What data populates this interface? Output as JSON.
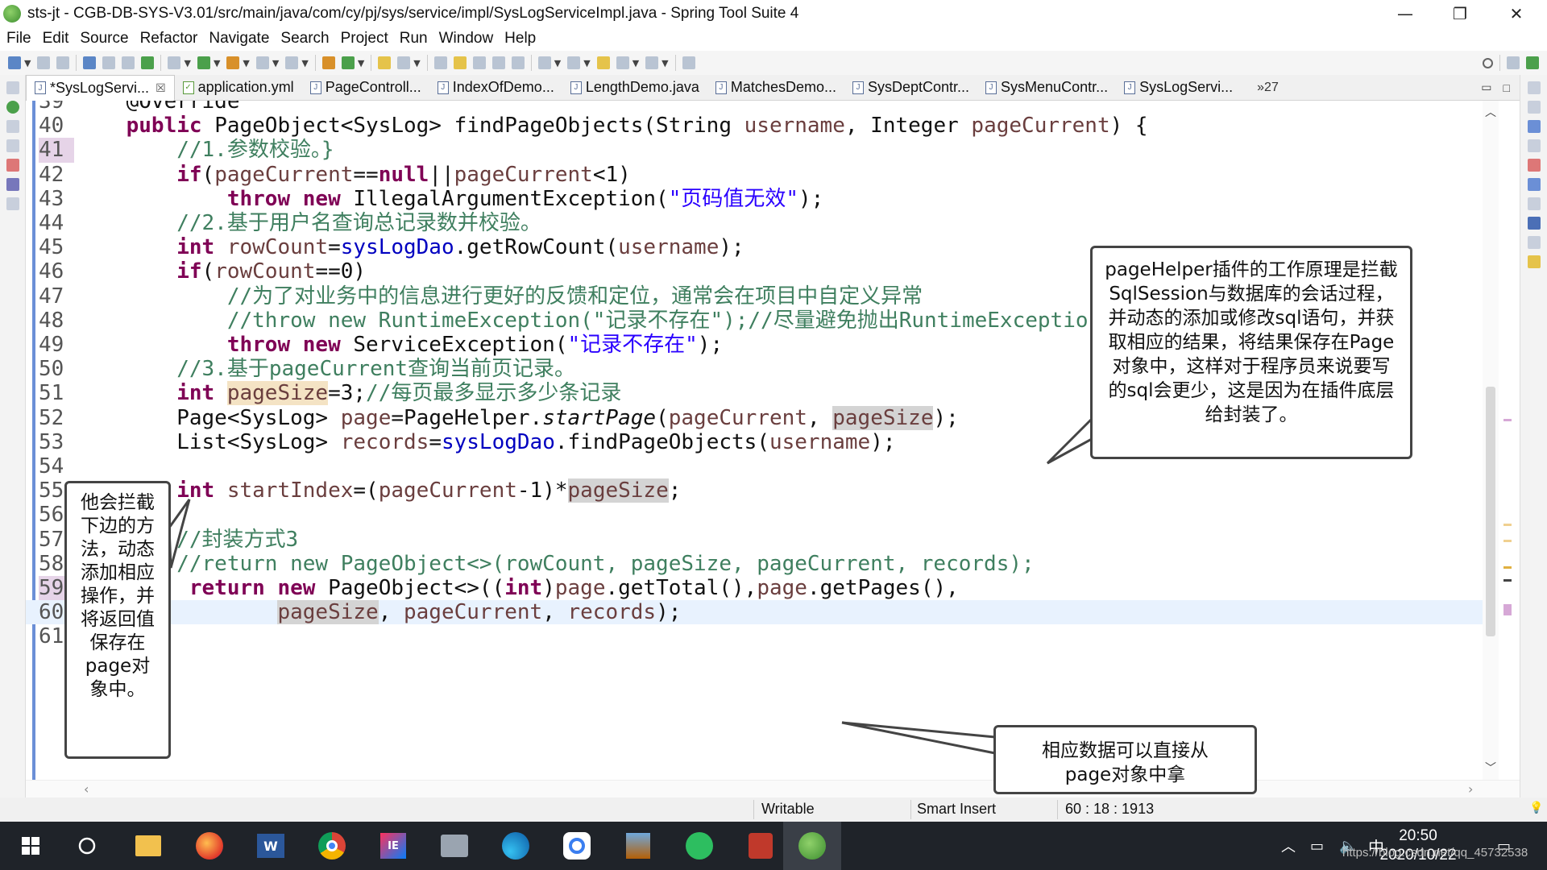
{
  "window": {
    "title": "sts-jt - CGB-DB-SYS-V3.01/src/main/java/com/cy/pj/sys/service/impl/SysLogServiceImpl.java - Spring Tool Suite 4",
    "minimize": "—",
    "restore": "❐",
    "close": "✕"
  },
  "menu": [
    "File",
    "Edit",
    "Source",
    "Refactor",
    "Navigate",
    "Search",
    "Project",
    "Run",
    "Window",
    "Help"
  ],
  "tabs": [
    {
      "label": "*SysLogServi...",
      "active": true,
      "close": "☒"
    },
    {
      "label": "application.yml"
    },
    {
      "label": "PageControll..."
    },
    {
      "label": "IndexOfDemo..."
    },
    {
      "label": "LengthDemo.java"
    },
    {
      "label": "MatchesDemo..."
    },
    {
      "label": "SysDeptContr..."
    },
    {
      "label": "SysMenuContr..."
    },
    {
      "label": "SysLogServi..."
    }
  ],
  "tabs_overflow": "»27",
  "code": {
    "lines": [
      {
        "n": "39",
        "segs": [
          [
            "",
            "    @Override"
          ]
        ]
      },
      {
        "n": "40",
        "segs": [
          [
            "kw",
            "    public "
          ],
          [
            "",
            "PageObject<SysLog> findPageObjects(String "
          ],
          [
            "var",
            "username"
          ],
          [
            "",
            ", Integer "
          ],
          [
            "var",
            "pageCurrent"
          ],
          [
            "",
            ") {"
          ]
        ]
      },
      {
        "n": "41",
        "segs": [
          [
            "cm",
            "        //1.参数校验。}"
          ]
        ],
        "lnhl": true
      },
      {
        "n": "42",
        "segs": [
          [
            "kw",
            "        if"
          ],
          [
            "",
            "("
          ],
          [
            "var",
            "pageCurrent"
          ],
          [
            "",
            "=="
          ],
          [
            "kw",
            "null"
          ],
          [
            "",
            "||"
          ],
          [
            "var",
            "pageCurrent"
          ],
          [
            "",
            "<1)"
          ]
        ]
      },
      {
        "n": "43",
        "segs": [
          [
            "kw",
            "            throw new "
          ],
          [
            "",
            "IllegalArgumentException("
          ],
          [
            "st",
            "\"页码值无效\""
          ],
          [
            "",
            ");"
          ]
        ]
      },
      {
        "n": "44",
        "segs": [
          [
            "cm",
            "        //2.基于用户名查询总记录数并校验。"
          ]
        ]
      },
      {
        "n": "45",
        "segs": [
          [
            "kw",
            "        int "
          ],
          [
            "var",
            "rowCount"
          ],
          [
            "",
            "="
          ],
          [
            "fld",
            "sysLogDao"
          ],
          [
            "",
            ".getRowCount("
          ],
          [
            "var",
            "username"
          ],
          [
            "",
            ");"
          ]
        ]
      },
      {
        "n": "46",
        "segs": [
          [
            "kw",
            "        if"
          ],
          [
            "",
            "("
          ],
          [
            "var",
            "rowCount"
          ],
          [
            "",
            "==0)"
          ]
        ]
      },
      {
        "n": "47",
        "segs": [
          [
            "cm",
            "            //为了对业务中的信息进行更好的反馈和定位，通常会在项目中自定义异常"
          ]
        ]
      },
      {
        "n": "48",
        "segs": [
          [
            "cm",
            "            //throw new RuntimeException(\"记录不存在\");//尽量避免抛出RuntimeException"
          ]
        ]
      },
      {
        "n": "49",
        "segs": [
          [
            "kw",
            "            throw new "
          ],
          [
            "",
            "ServiceException("
          ],
          [
            "st",
            "\"记录不存在\""
          ],
          [
            "",
            ");"
          ]
        ]
      },
      {
        "n": "50",
        "segs": [
          [
            "cm",
            "        //3.基于pageCurrent查询当前页记录。"
          ]
        ]
      },
      {
        "n": "51",
        "segs": [
          [
            "kw",
            "        int "
          ],
          [
            "var occ",
            "pageSize"
          ],
          [
            "",
            "=3;"
          ],
          [
            "cm",
            "//每页最多显示多少条记录"
          ]
        ]
      },
      {
        "n": "52",
        "segs": [
          [
            "",
            "        Page<SysLog> "
          ],
          [
            "var",
            "page"
          ],
          [
            "",
            "=PageHelper."
          ],
          [
            "it",
            "startPage"
          ],
          [
            "",
            "("
          ],
          [
            "var",
            "pageCurrent"
          ],
          [
            "",
            ", "
          ],
          [
            "var occ2",
            "pageSize"
          ],
          [
            "",
            ");"
          ]
        ]
      },
      {
        "n": "53",
        "segs": [
          [
            "",
            "        List<SysLog> "
          ],
          [
            "var",
            "records"
          ],
          [
            "",
            "="
          ],
          [
            "fld",
            "sysLogDao"
          ],
          [
            "",
            ".findPageObjects("
          ],
          [
            "var",
            "username"
          ],
          [
            "",
            ");"
          ]
        ]
      },
      {
        "n": "54",
        "segs": [
          [
            "",
            ""
          ]
        ]
      },
      {
        "n": "55",
        "segs": [
          [
            "kw",
            "        int "
          ],
          [
            "var",
            "startIndex"
          ],
          [
            "",
            "=("
          ],
          [
            "var",
            "pageCurrent"
          ],
          [
            "",
            "-1)*"
          ],
          [
            "var occ2",
            "pageSize"
          ],
          [
            "",
            ";"
          ]
        ]
      },
      {
        "n": "56",
        "segs": [
          [
            "",
            ""
          ]
        ]
      },
      {
        "n": "57",
        "segs": [
          [
            "cm",
            "        //封装方式3"
          ]
        ]
      },
      {
        "n": "58",
        "segs": [
          [
            "cm",
            "        //return new PageObject<>(rowCount, pageSize, pageCurrent, records);"
          ]
        ]
      },
      {
        "n": "59",
        "segs": [
          [
            "kw",
            "         return new "
          ],
          [
            "",
            "PageObject<>(("
          ],
          [
            "kw",
            "int"
          ],
          [
            "",
            ")"
          ],
          [
            "var",
            "page"
          ],
          [
            "",
            ".getTotal(),"
          ],
          [
            "var",
            "page"
          ],
          [
            "",
            ".getPages(),"
          ]
        ],
        "lnhl": true
      },
      {
        "n": "60",
        "segs": [
          [
            "",
            "                "
          ],
          [
            "var occ2",
            "pageSize"
          ],
          [
            "",
            ", "
          ],
          [
            "var",
            "pageCurrent"
          ],
          [
            "",
            ", "
          ],
          [
            "var",
            "records"
          ],
          [
            "",
            ");"
          ]
        ],
        "current": true
      },
      {
        "n": "61",
        "segs": [
          [
            "",
            "    }"
          ]
        ]
      }
    ]
  },
  "callouts": {
    "right_top": "pageHelper插件的工作原理是拦截SqlSession与数据库的会话过程，并动态的添加或修改sql语句，并获取相应的结果，将结果保存在Page对象中，这样对于程序员来说要写的sql会更少，这是因为在插件底层给封装了。",
    "left": "他会拦截下边的方法，动态添加相应操作，并将返回值保存在page对象中。",
    "bottom_right": "相应数据可以直接从page对象中拿"
  },
  "status": {
    "mode": "Writable",
    "insert": "Smart Insert",
    "position": "60 : 18 : 1913"
  },
  "taskbar": {
    "apps": [
      "start",
      "search",
      "file-explorer",
      "firefox",
      "word",
      "chrome",
      "intellij",
      "network",
      "edge",
      "baidu-netdisk",
      "winrar",
      "evernote",
      "tools",
      "spring-tool-suite"
    ],
    "ime": "中",
    "time": "20:50",
    "date": "2020/10/22",
    "watermark": "https://blog.csdn.net/qq_45732538"
  }
}
